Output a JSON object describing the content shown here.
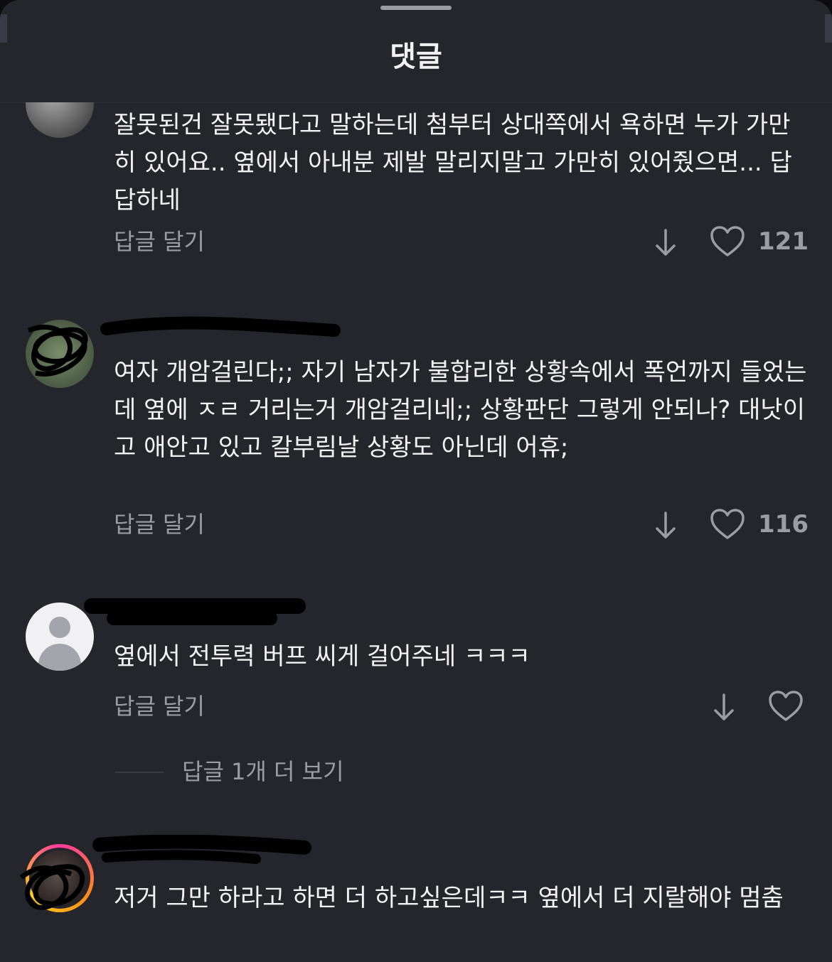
{
  "header": {
    "title": "댓글"
  },
  "comments": [
    {
      "text": "잘못된건 잘못됐다고 말하는데 첨부터 상대쪽에서 욕하면 누가 가만히 있어요.. 옆에서 아내분 제발 말리지말고 가만히 있어줬으면... 답답하네",
      "reply_label": "답글 달기",
      "likes": "121",
      "avatar_icon": "photo-avatar"
    },
    {
      "text": "여자 개암걸린다;; 자기 남자가 불합리한 상황속에서 폭언까지 들었는데 옆에 ㅈㄹ 거리는거 개암걸리네;; 상황판단 그렇게 안되나? 대낫이고 애안고 있고 칼부림날 상황도 아닌데 어휴;",
      "reply_label": "답글 달기",
      "likes": "116",
      "avatar_icon": "photo-avatar"
    },
    {
      "text": "옆에서 전투력 버프 씨게 걸어주네 ㅋㅋㅋ",
      "reply_label": "답글 달기",
      "likes": "",
      "view_more": "답글 1개 더 보기",
      "avatar_icon": "default-user-avatar"
    },
    {
      "text": "저거 그만 하라고 하면 더 하고싶은데ㅋㅋ 옆에서 더 지랄해야 멈춤",
      "avatar_icon": "story-ring-avatar"
    }
  ],
  "icons": {
    "dislike": "arrow-down-icon",
    "like": "heart-icon"
  },
  "colors": {
    "background": "#25262b",
    "text": "#f2f2f4",
    "muted": "#9c9ca3"
  }
}
